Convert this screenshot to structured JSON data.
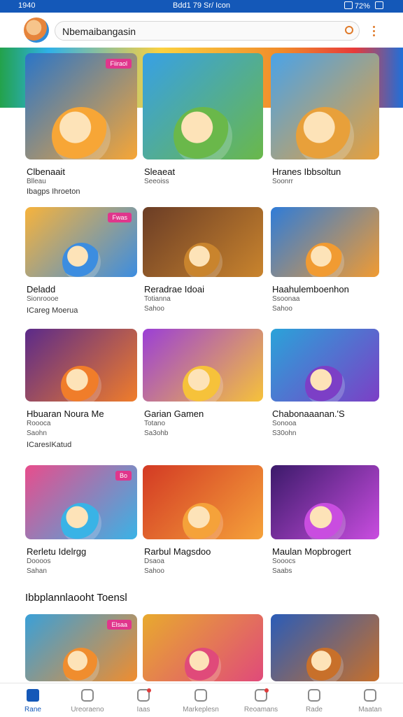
{
  "status_bar": {
    "time": "1940",
    "center": "Bdd1 79 Sr/ Icon",
    "right": "72%"
  },
  "header": {
    "search_text": "Nbemaibangasin"
  },
  "colors": {
    "primary": "#1458b8",
    "accent": "#e07a2a"
  },
  "rows": [
    {
      "cards": [
        {
          "title": "Clbenaait",
          "meta": "Blleau",
          "badge": "Fiiraol",
          "colors": [
            "#2a75c8",
            "#f7a636"
          ]
        },
        {
          "title": "Sleaeat",
          "meta": "Seeoiss",
          "colors": [
            "#37a0e6",
            "#6ab84a"
          ]
        },
        {
          "title": "Hranes Ibbsoltun",
          "meta": "Soonrr",
          "colors": [
            "#4aa3e8",
            "#e8a03a"
          ]
        }
      ],
      "tag": "Ibagps Ihroeton"
    },
    {
      "cards": [
        {
          "title": "Deladd",
          "meta": "Sionroooe",
          "badge": "Fwas",
          "colors": [
            "#f7b33c",
            "#3c8de0"
          ]
        },
        {
          "title": "Reradrae Idoai",
          "meta": "Totianna",
          "meta2": "Sahoo",
          "colors": [
            "#6b3d26",
            "#c9842d"
          ]
        },
        {
          "title": "Haahulemboenhon",
          "meta": "Ssoonaa",
          "meta2": "Sahoo",
          "colors": [
            "#2f7cd8",
            "#f19b32"
          ]
        }
      ],
      "tag": "ICareg Moerua"
    },
    {
      "cards": [
        {
          "title": "Hbuaran Noura Me",
          "meta": "Roooca",
          "meta2": "Saohn",
          "colors": [
            "#5b2a8a",
            "#f07d2a"
          ]
        },
        {
          "title": "Garian Gamen",
          "meta": "Totano",
          "meta2": "Sa3ohb",
          "colors": [
            "#9b3fd6",
            "#f6c23a"
          ]
        },
        {
          "title": "Chabonaaanan.'S",
          "meta": "Sonooa",
          "meta2": "S30ohn",
          "colors": [
            "#2aa3d9",
            "#7c3fc6"
          ]
        }
      ],
      "tag": "ICaresIKatud"
    },
    {
      "cards": [
        {
          "title": "Rerletu Idelrgg",
          "meta": "Doooos",
          "meta2": "Sahan",
          "badge": "Bo",
          "colors": [
            "#e84d8c",
            "#39b3e6"
          ]
        },
        {
          "title": "Rarbul Magsdoo",
          "meta": "Dsaoa",
          "meta2": "Sahoo",
          "colors": [
            "#d33a24",
            "#f5a23a"
          ]
        },
        {
          "title": "Maulan Mopbrogert",
          "meta": "Sooocs",
          "meta2": "Saabs",
          "colors": [
            "#3b1a6a",
            "#c94de0"
          ]
        }
      ]
    }
  ],
  "section_title": "Ibbplannlaooht Toensl",
  "bottom_row": [
    {
      "badge": "Elsaa",
      "colors": [
        "#3aa0d8",
        "#f08d2e"
      ]
    },
    {
      "colors": [
        "#e8aa2e",
        "#e04a7a"
      ]
    },
    {
      "colors": [
        "#2a5cb8",
        "#c8702a"
      ]
    }
  ],
  "nav": [
    {
      "label": "Rane",
      "active": true
    },
    {
      "label": "Ureoraeno",
      "active": false
    },
    {
      "label": "Iaas",
      "active": false,
      "dot": true
    },
    {
      "label": "Markeplesn",
      "active": false
    },
    {
      "label": "Reoamans",
      "active": false,
      "dot": true
    },
    {
      "label": "Rade",
      "active": false
    },
    {
      "label": "Maatan",
      "active": false
    }
  ]
}
